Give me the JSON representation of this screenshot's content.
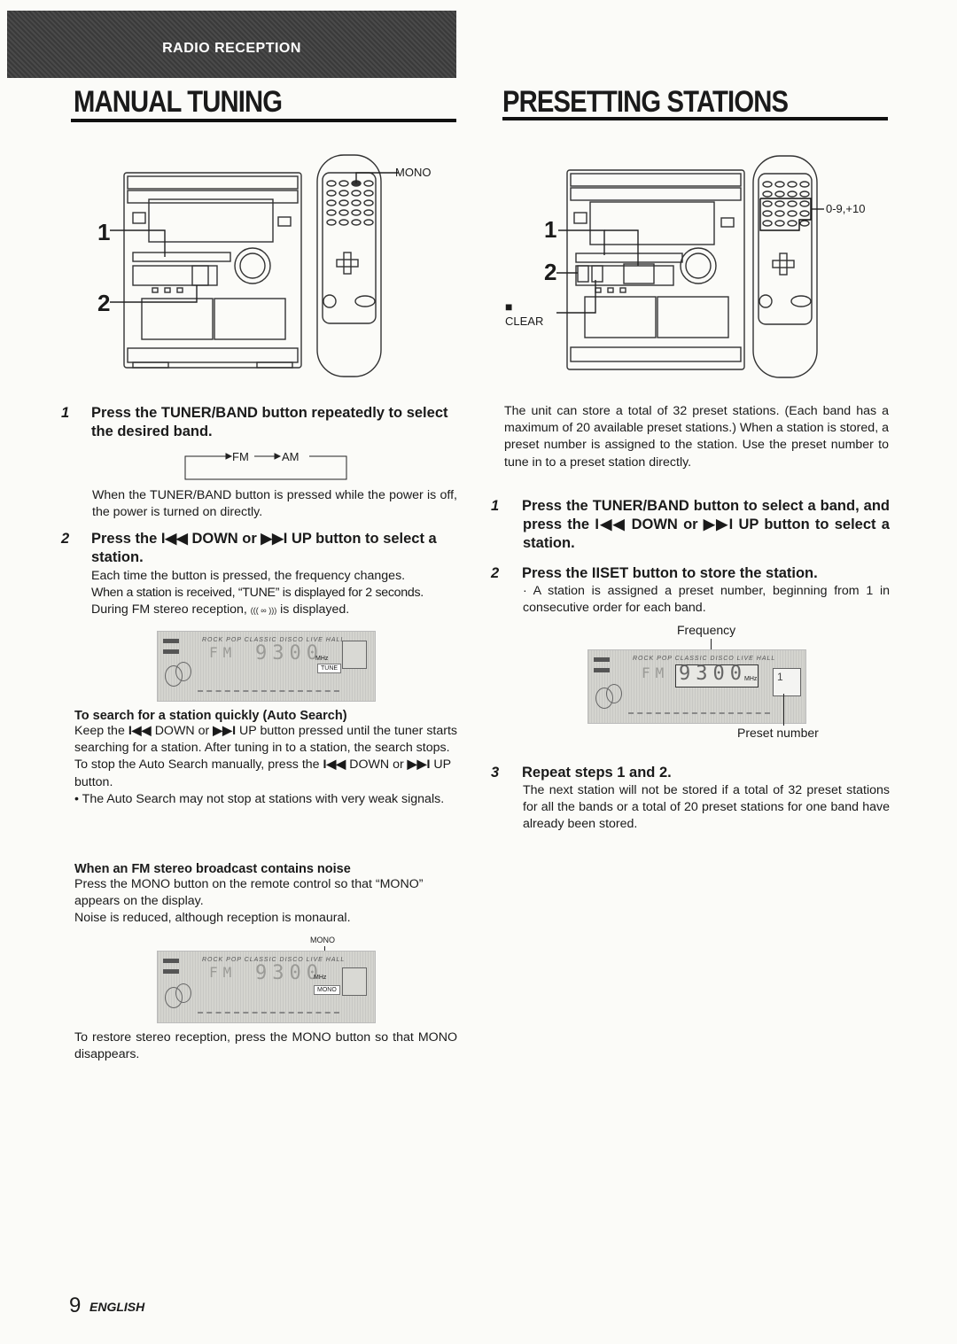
{
  "header": {
    "section": "RADIO RECEPTION",
    "left_title": "MANUAL TUNING",
    "right_title": "PRESETTING STATIONS"
  },
  "manual_tuning": {
    "figure": {
      "callout_1": "1",
      "callout_2": "2",
      "mono_label": "MONO"
    },
    "step1": {
      "num": "1",
      "title": "Press the TUNER/BAND button repeatedly to select the desired band.",
      "band_cycle": [
        "FM",
        "AM"
      ],
      "note": "When the TUNER/BAND button is pressed while the power is off, the power is turned on directly."
    },
    "step2": {
      "num": "2",
      "title_a": "Press the",
      "down_symbol": "I◀◀",
      "title_b": "DOWN or",
      "up_symbol": "▶▶I",
      "title_c": "UP button to select a station.",
      "line1": "Each time the button is pressed, the frequency changes.",
      "line2": "When a station is received, “TUNE” is displayed for 2 seconds.",
      "line3_a": "During FM stereo reception,",
      "stereo_symbol": "((( ∞ )))",
      "line3_b": "is displayed."
    },
    "display1": {
      "modes": "ROCK  POP  CLASSIC  DISCO  LIVE  HALL",
      "band": "FM",
      "frequency": "9300",
      "unit": "MHz",
      "indicator": "TUNE"
    },
    "auto_search": {
      "heading": "To search for a station quickly (Auto Search)",
      "p1_a": "Keep the",
      "p1_b": "DOWN or",
      "p1_c": "UP button pressed until the tuner starts searching for a station.  After tuning in to a station, the search stops.",
      "p2_a": "To stop the Auto Search manually, press the",
      "p2_b": "DOWN or",
      "p2_c": "UP button.",
      "bullet": "• The Auto Search may not stop at stations with very weak signals."
    },
    "noise": {
      "heading": "When an FM stereo broadcast contains noise",
      "p1": "Press the MONO button on the remote control so that “MONO” appears on the display.",
      "p2": "Noise is reduced, although reception is monaural.",
      "mono_callout": "MONO",
      "restore": "To restore stereo reception, press the MONO button so that MONO disappears."
    },
    "display2": {
      "modes": "ROCK  POP  CLASSIC  DISCO  LIVE  HALL",
      "band": "FM",
      "frequency": "9300",
      "unit": "MHz",
      "indicator": "MONO"
    }
  },
  "presetting": {
    "figure": {
      "callout_1": "1",
      "callout_2": "2",
      "clear_symbol": "■",
      "clear_label": "CLEAR",
      "numpad_label": "0-9,+10"
    },
    "intro": "The unit can store a total of 32 preset stations. (Each band has a maximum of 20 available preset stations.) When a station is stored, a preset number is assigned to the station.  Use the preset number to tune in to a preset station directly.",
    "step1": {
      "num": "1",
      "title_a": "Press the TUNER/BAND button to select a band, and press the",
      "title_b": "DOWN or",
      "title_c": "UP button to select a station."
    },
    "step2": {
      "num": "2",
      "title_a": "Press the",
      "set_symbol": "II",
      "title_b": "SET button to store the station.",
      "note": "· A station is assigned a preset number, beginning from 1 in consecutive order for each band."
    },
    "display": {
      "frequency_label": "Frequency",
      "preset_label": "Preset number",
      "modes": "ROCK  POP  CLASSIC  DISCO  LIVE  HALL",
      "band": "FM",
      "frequency": "9300",
      "unit": "MHz",
      "preset": "1"
    },
    "step3": {
      "num": "3",
      "title": "Repeat steps 1 and 2.",
      "note": "The next station will not be stored if a total of 32 preset stations for all the bands or a total of 20 preset stations for one band have already been stored."
    }
  },
  "footer": {
    "page_number": "9",
    "language": "ENGLISH"
  }
}
